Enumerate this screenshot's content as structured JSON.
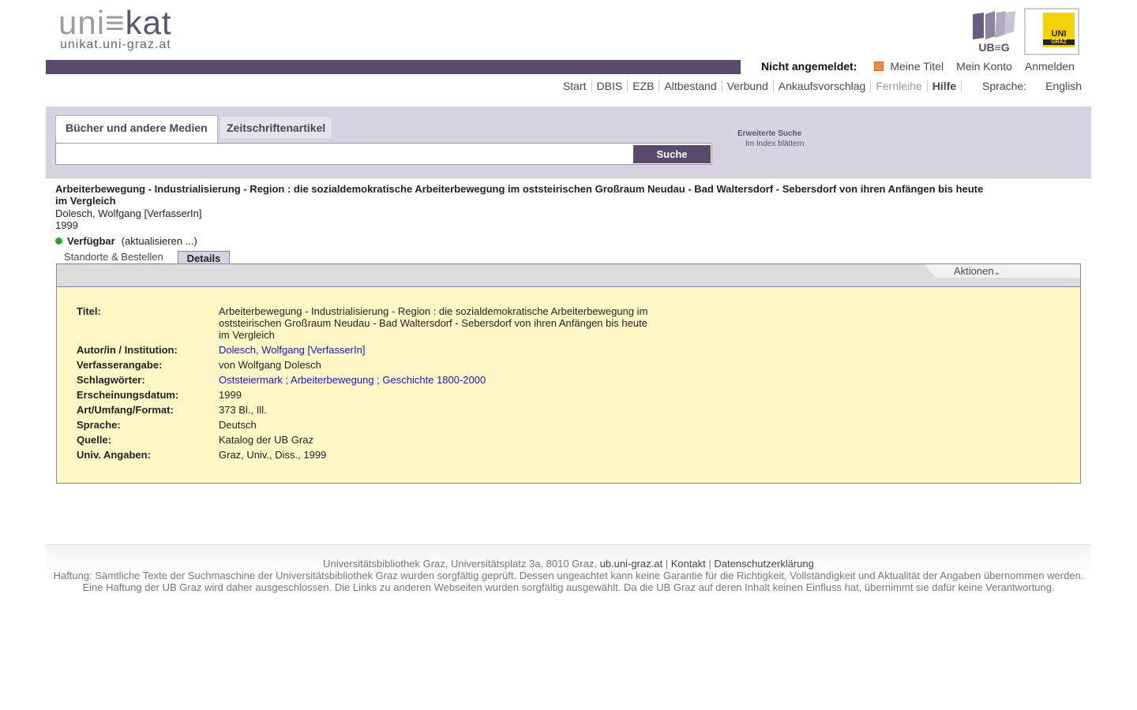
{
  "header": {
    "logo_text_1": "uni",
    "logo_text_2": "≡",
    "logo_text_3": "kat",
    "logo_sub": "unikat.uni-graz.at",
    "ub_logo_text": "UB≡G",
    "uni_logo_top": "UNI",
    "uni_logo_bottom": "GRAZ"
  },
  "user_nav": {
    "status": "Nicht angemeldet:",
    "items": [
      "Meine Titel",
      "Mein Konto",
      "Anmelden"
    ]
  },
  "main_nav": {
    "items": [
      "Start",
      "DBIS",
      "EZB",
      "Altbestand",
      "Verbund",
      "Ankaufsvorschlag",
      "Fernleihe",
      "Hilfe"
    ],
    "language_label": "Sprache:",
    "language_value": "English"
  },
  "search": {
    "tab_active": "Bücher und andere Medien",
    "tab_inactive": "Zeitschriftenartikel",
    "input_value": "",
    "button": "Suche",
    "advanced": "Erweiterte Suche",
    "index": "Im Index blättern"
  },
  "record": {
    "title": "Arbeiterbewegung - Industrialisierung - Region : die sozialdemokratische Arbeiterbewegung im oststeirischen Großraum Neudau - Bad Waltersdorf - Sebersdorf von ihren Anfängen bis heute im Vergleich",
    "author": "Dolesch, Wolfgang [VerfasserIn]",
    "year": "1999",
    "availability": "Verfügbar",
    "refresh": "(aktualisieren ...)",
    "tab_locations": "Standorte & Bestellen",
    "tab_details": "Details",
    "actions": "Aktionen"
  },
  "details": {
    "titel_label": "Titel:",
    "titel_value": "Arbeiterbewegung - Industrialisierung - Region : die sozialdemokratische Arbeiterbewegung im oststeirischen Großraum Neudau - Bad Waltersdorf - Sebersdorf von ihren Anfängen bis heute im Vergleich",
    "autor_label": "Autor/in / Institution:",
    "autor_value": "Dolesch, Wolfgang [VerfasserIn]",
    "verf_label": "Verfasserangabe:",
    "verf_value": "von Wolfgang Dolesch",
    "schlag_label": "Schlagwörter:",
    "schlag_1": "Oststeiermark",
    "schlag_sep": " ; ",
    "schlag_2": "Arbeiterbewegung",
    "schlag_3": "Geschichte 1800-2000",
    "datum_label": "Erscheinungsdatum:",
    "datum_value": "1999",
    "art_label": "Art/Umfang/Format:",
    "art_value": "373 Bl., Ill.",
    "sprache_label": "Sprache:",
    "sprache_value": "Deutsch",
    "quelle_label": "Quelle:",
    "quelle_value": "Katalog der UB Graz",
    "univ_label": "Univ. Angaben:",
    "univ_value": "Graz, Univ., Diss., 1999"
  },
  "footer": {
    "address": "Universitätsbibliothek Graz, Universitätsplatz 3a, 8010 Graz, ",
    "link_site": "ub.uni-graz.at",
    "sep": " | ",
    "link_contact": "Kontakt",
    "link_privacy": "Datenschutzerklärung",
    "disclaimer_1": "Haftung: Sämtliche Texte der Suchmaschine der Universitätsbibliothek Graz wurden sorgfältig geprüft. Dessen ungeachtet kann keine Garantie für die Richtigkeit, Vollständigkeit und Aktualität der Angaben übernommen werden.",
    "disclaimer_2": "Eine Haftung der UB Graz wird daher ausgeschlossen. Die Links zu anderen Webseiten wurden sorgfältig ausgewählt. Da die UB Graz auf deren Inhalt keinen Einfluss hat, übernimmt sie dafür keine Verantwortung."
  },
  "colors": {
    "brand_purple": "#584b6c",
    "search_bg": "#d7d3e0",
    "detail_bg": "#fff8c6",
    "link_blue": "#1a1aa6",
    "available_green": "#2ca52c"
  }
}
